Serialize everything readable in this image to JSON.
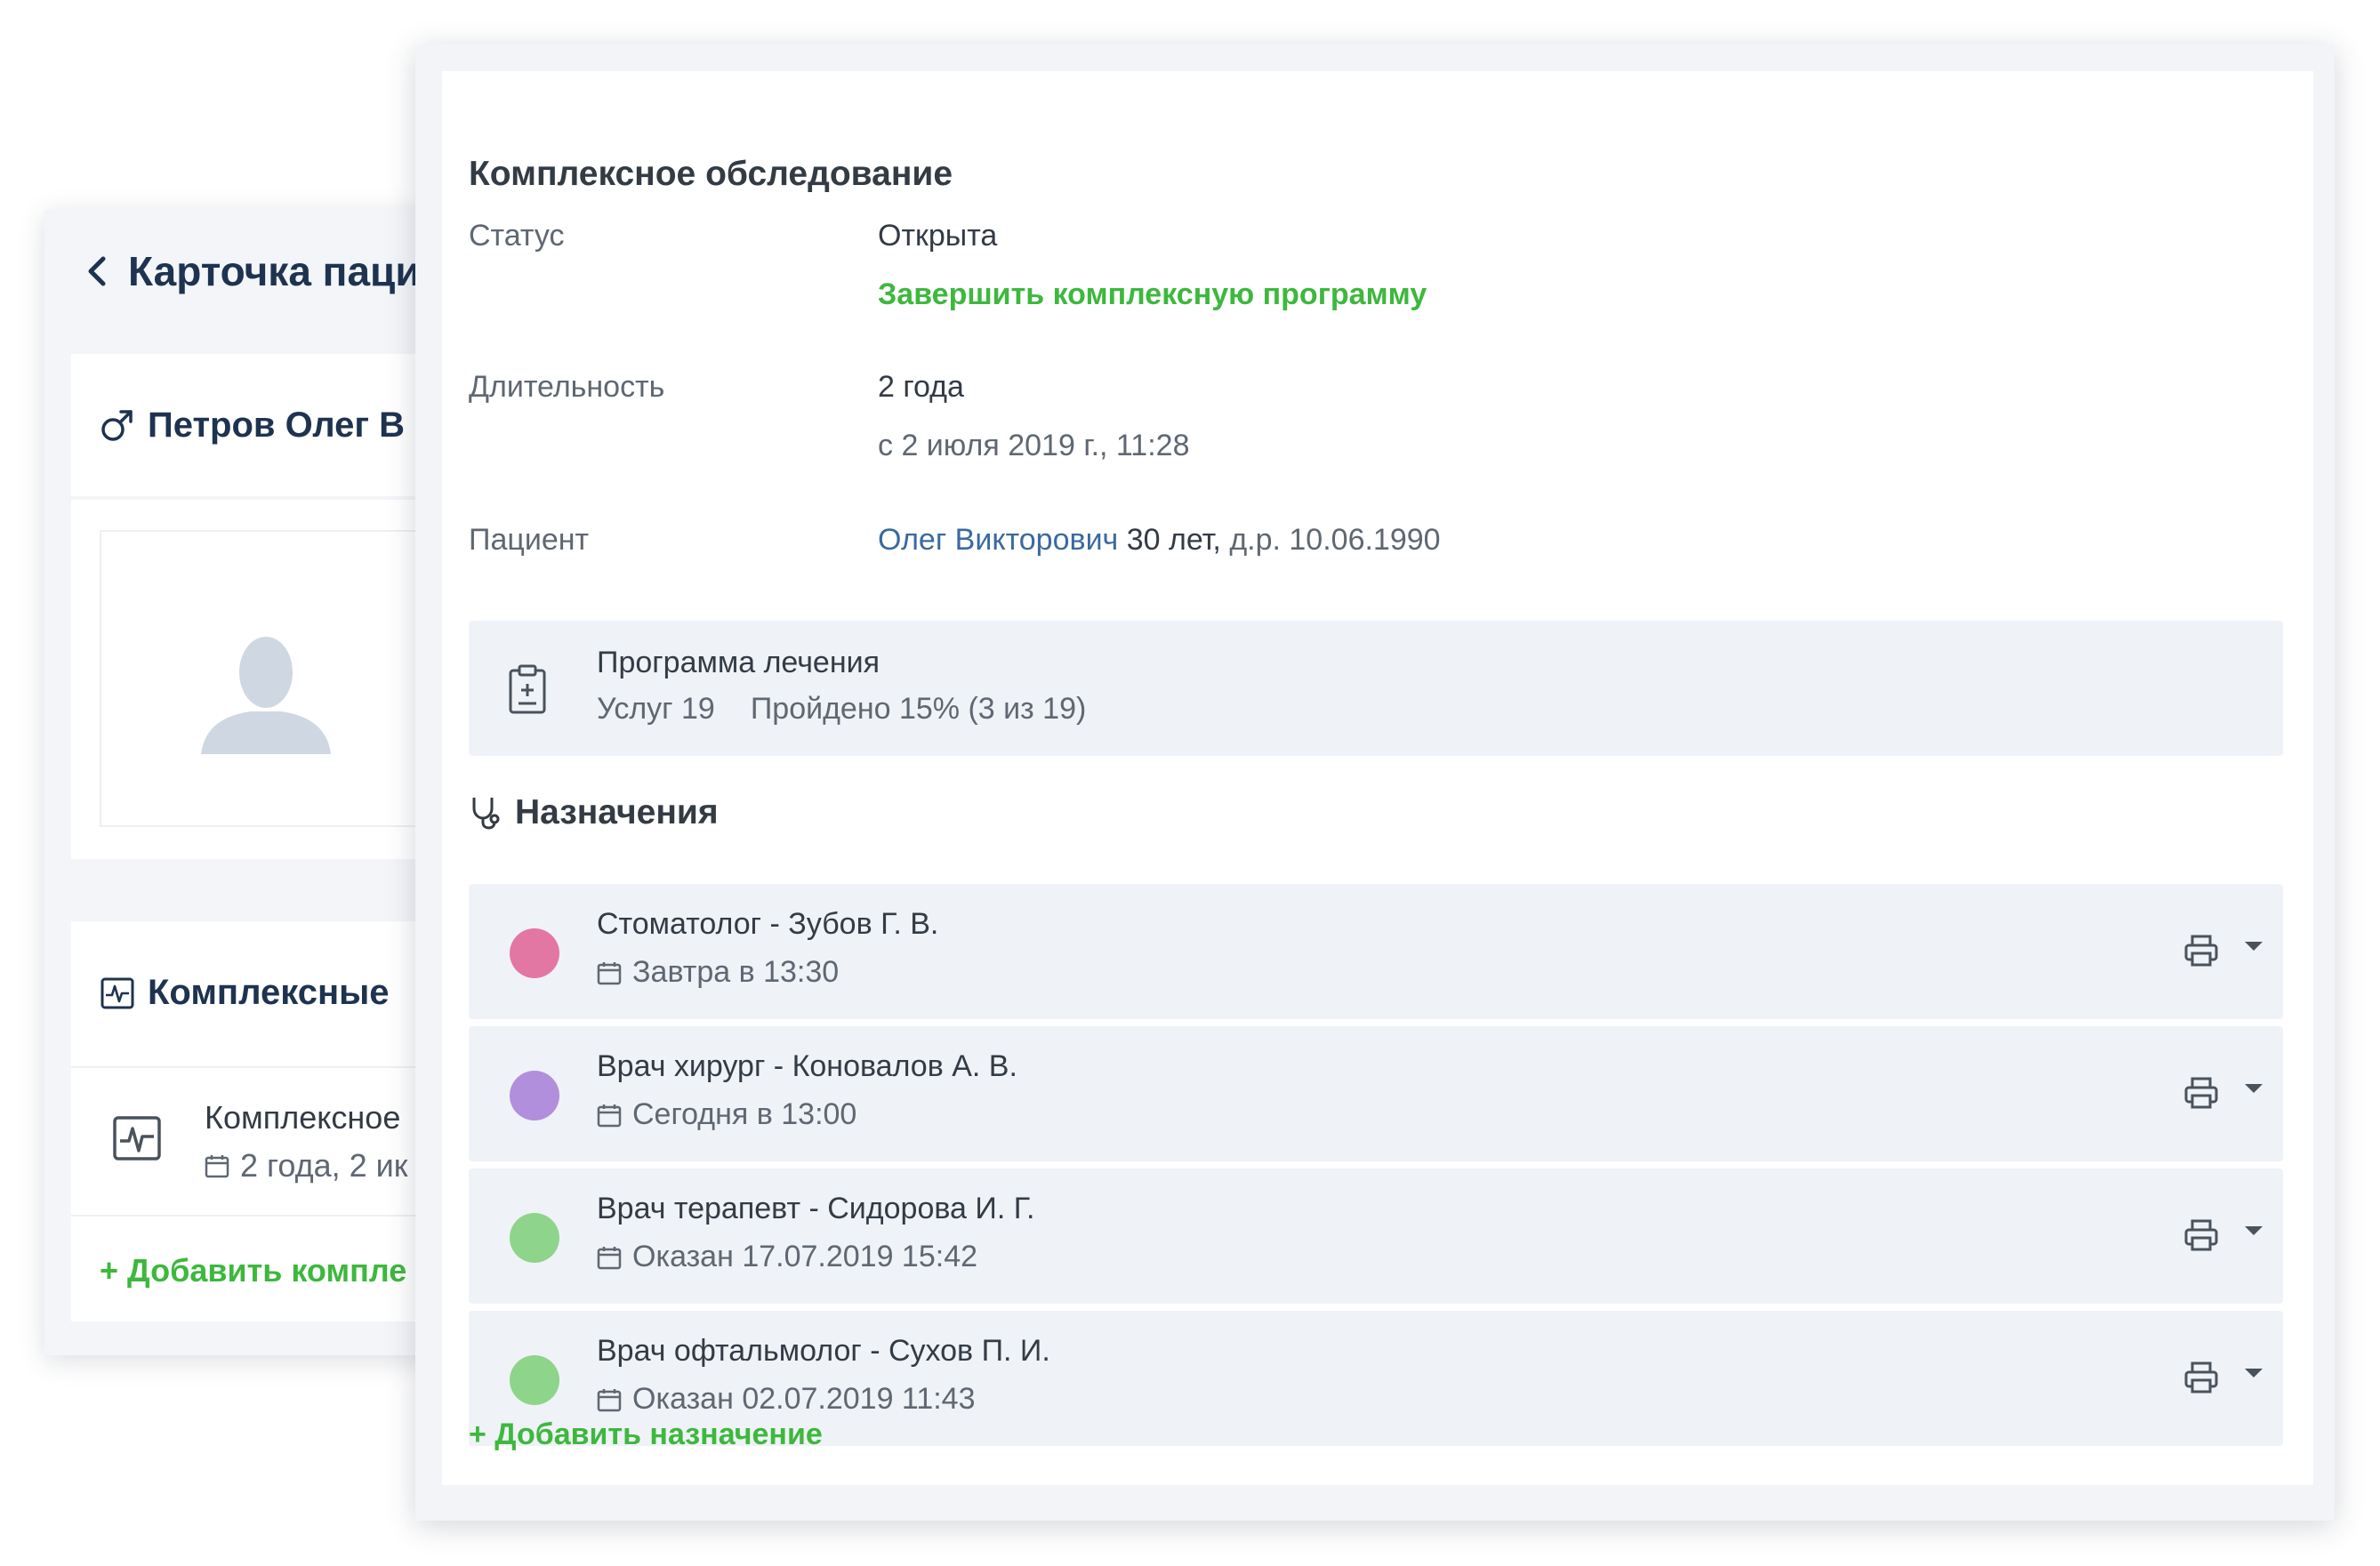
{
  "patient_card": {
    "back_label": "Карточка пациента",
    "patient_name": "Петров Олег В",
    "complex_section_title": "Комплексные",
    "complex_item_title": "Комплексное",
    "complex_item_sub": "2 года, 2 ик",
    "add_complex_label": "+ Добавить компле"
  },
  "exam": {
    "title": "Комплексное обследование",
    "status_label": "Статус",
    "status_value": "Открыта",
    "finish_action": "Завершить комплексную программу",
    "duration_label": "Длительность",
    "duration_value": "2 года",
    "duration_since": "с 2 июля 2019 г., 11:28",
    "patient_label": "Пациент",
    "patient_link": "Олег Викторович",
    "patient_age": " 30 лет, ",
    "patient_dob": "д.р. 10.06.1990"
  },
  "program": {
    "title": "Программа лечения",
    "services": "Услуг 19",
    "progress": "Пройдено 15% (3 из 19)"
  },
  "assignments": {
    "title": "Назначения",
    "items": [
      {
        "title": "Стоматолог - Зубов Г. В.",
        "when": "Завтра в 13:30",
        "color": "#e377a4"
      },
      {
        "title": "Врач хирург - Коновалов А. В.",
        "when": "Сегодня в 13:00",
        "color": "#b18fdc"
      },
      {
        "title": "Врач терапевт - Сидорова И. Г.",
        "when": "Оказан 17.07.2019 15:42",
        "color": "#8ed48a"
      },
      {
        "title": "Врач офтальмолог - Сухов П. И.",
        "when": "Оказан 02.07.2019 11:43",
        "color": "#8ed48a"
      }
    ],
    "add_label": "+ Добавить назначение"
  },
  "colors": {
    "accent_green": "#3db83d",
    "link_blue": "#3a6aa0",
    "heading_dark": "#1e3350"
  }
}
